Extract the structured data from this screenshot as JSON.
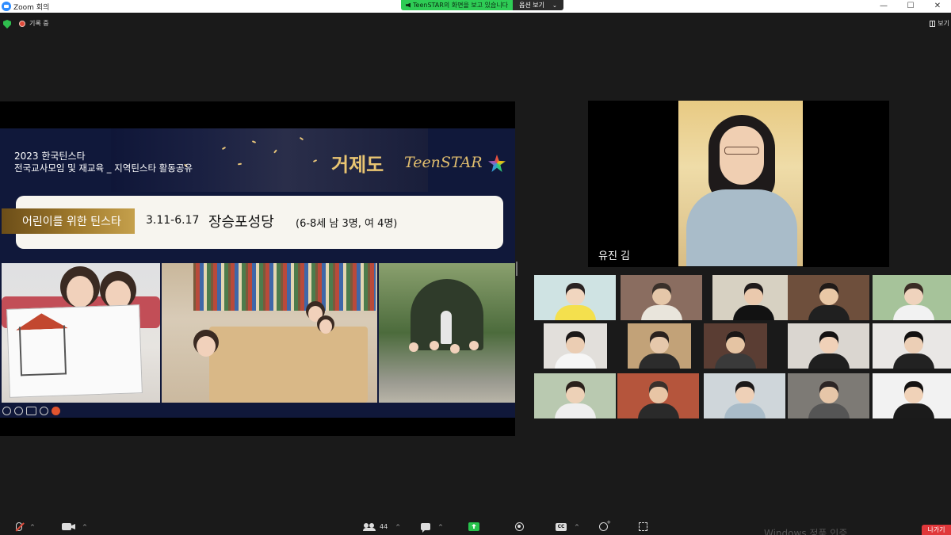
{
  "window": {
    "title": "Zoom 회의",
    "controls": [
      "—",
      "☐",
      "✕"
    ]
  },
  "share_banner": {
    "text": "TeenSTAR의 화면을 보고 있습니다",
    "view_options_label": "옵션 보기",
    "chevron": "⌄"
  },
  "top_bar": {
    "recording_label": "기록 중",
    "view_label": "보기",
    "icons": [
      "shield-icon",
      "record-dot-icon",
      "grid-view-icon"
    ]
  },
  "slide": {
    "title_line1": "2023 한국틴스타",
    "title_line2": "전국교사모임 및 재교육 _ 지역틴스타 활동공유",
    "logo_korean": "거제도",
    "logo_english": "TeenSTAR",
    "tab_label": "어린이를 위한 틴스타",
    "date_range": "3.11-6.17",
    "place": "장승포성당",
    "participants_note": "(6-8세 남 3명, 여 4명)"
  },
  "speaker": {
    "name": "유진 김"
  },
  "gallery": {
    "tiles": [
      {
        "bg": "#cfe3e3",
        "skin": "#f1d6bf",
        "hair": "#2a2323",
        "cloth": "#f4e04d"
      },
      {
        "bg": "#8a6d60",
        "skin": "#e5c7a9",
        "hair": "#3a302a",
        "cloth": "#e9e5dc"
      },
      {
        "bg": "#d7d1c2",
        "skin": "#eac9ad",
        "hair": "#1f1b1b",
        "cloth": "#121212"
      },
      {
        "bg": "#6e4f3c",
        "skin": "#e9c8a6",
        "hair": "#201a18",
        "cloth": "#202020"
      },
      {
        "bg": "#a6c39a",
        "skin": "#efd3bd",
        "hair": "#3a2d25",
        "cloth": "#f2f2f2"
      },
      {
        "bg": "#e2dfdb",
        "skin": "#ebcdb3",
        "hair": "#1b1818",
        "cloth": "#f6f6f6"
      },
      {
        "bg": "#c2a278",
        "skin": "#e6c8ab",
        "hair": "#2a211d",
        "cloth": "#2c2c2c"
      },
      {
        "bg": "#5a3d33",
        "skin": "#e5c4a3",
        "hair": "#1a1616",
        "cloth": "#3a3a3a"
      },
      {
        "bg": "#dad6d0",
        "skin": "#f0d1b8",
        "hair": "#141212",
        "cloth": "#1f1f1f"
      },
      {
        "bg": "#e9e7e5",
        "skin": "#eccfb6",
        "hair": "#121010",
        "cloth": "#222222"
      },
      {
        "bg": "#b9c9b0",
        "skin": "#edd1b7",
        "hair": "#2a211c",
        "cloth": "#efefef"
      },
      {
        "bg": "#b5553c",
        "skin": "#e8c5a5",
        "hair": "#3a2f2a",
        "cloth": "#2a2a2a"
      },
      {
        "bg": "#cfd6da",
        "skin": "#eed0b7",
        "hair": "#1b1919",
        "cloth": "#a9bcc9"
      },
      {
        "bg": "#7d7a75",
        "skin": "#e6c6a8",
        "hair": "#2c2525",
        "cloth": "#555555"
      },
      {
        "bg": "#f2f2f2",
        "skin": "#f0d2b8",
        "hair": "#141212",
        "cloth": "#1b1b1b"
      }
    ]
  },
  "toolbar": {
    "participants_count": "44",
    "chevron": "^",
    "leave_label": "나가기"
  },
  "os_overlay": {
    "watermark": "Windows 정품 인증"
  },
  "colors": {
    "share_green": "#2ecc55",
    "leave_red": "#e0373a",
    "slide_navy": "#10183a",
    "logo_gold": "#e9c572"
  }
}
